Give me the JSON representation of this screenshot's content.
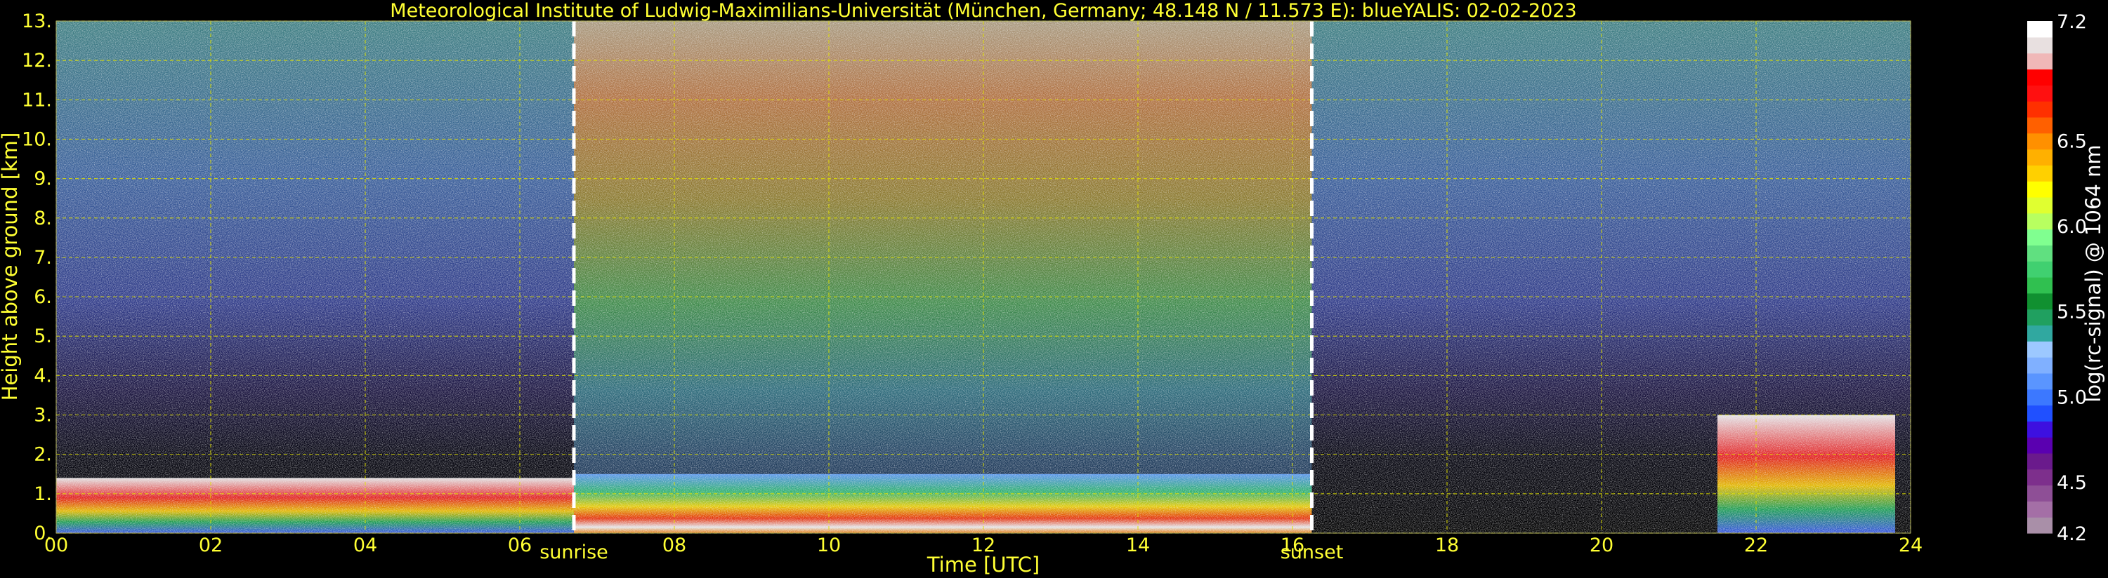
{
  "chart_data": {
    "type": "heatmap",
    "title": "Meteorological Institute of Ludwig-Maximilians-Universität (München, Germany; 48.148 N / 11.573 E):    blueYALIS: 02-02-2023",
    "xlabel": "Time [UTC]",
    "ylabel": "Height above ground [km]",
    "xlim": [
      0,
      24
    ],
    "ylim": [
      0,
      13
    ],
    "x_ticks": [
      "00",
      "02",
      "04",
      "06",
      "08",
      "10",
      "12",
      "14",
      "16",
      "18",
      "20",
      "22",
      "24"
    ],
    "x_tick_values": [
      0,
      2,
      4,
      6,
      8,
      10,
      12,
      14,
      16,
      18,
      20,
      22,
      24
    ],
    "y_ticks": [
      "0.",
      "1.",
      "2.",
      "3.",
      "4.",
      "5.",
      "6.",
      "7.",
      "8.",
      "9.",
      "10.",
      "11.",
      "12.",
      "13."
    ],
    "y_tick_values": [
      0,
      1,
      2,
      3,
      4,
      5,
      6,
      7,
      8,
      9,
      10,
      11,
      12,
      13
    ],
    "grid": true,
    "annotations": [
      {
        "text": "sunrise",
        "x": 6.7
      },
      {
        "text": "sunset",
        "x": 16.25
      }
    ],
    "colorbar": {
      "label": "log(rc-signal) @ 1064 nm",
      "range": [
        4.2,
        7.2
      ],
      "tick_labels": [
        "7.2",
        "6.5",
        "6.0",
        "5.5",
        "5.0",
        "4.5",
        "4.2"
      ],
      "tick_values": [
        7.2,
        6.5,
        6.0,
        5.5,
        5.0,
        4.5,
        4.2
      ],
      "colors": [
        "#a98fa8",
        "#a46fa6",
        "#8e4f96",
        "#7d2f8c",
        "#6a1a8c",
        "#5a00b0",
        "#3d10e0",
        "#2050ff",
        "#3c78ff",
        "#5a95ff",
        "#80b0ff",
        "#9cc8ff",
        "#30a8a0",
        "#20a060",
        "#109030",
        "#30c050",
        "#40d070",
        "#60e080",
        "#80ff90",
        "#b8ff60",
        "#e0ff30",
        "#ffff00",
        "#ffd000",
        "#ffb000",
        "#ff9000",
        "#ff6000",
        "#ff3000",
        "#ff1010",
        "#ff0000",
        "#f0b8b8",
        "#e8e0e0",
        "#ffffff"
      ]
    },
    "zones": [
      {
        "name": "night-aerosol-layer",
        "x": [
          0,
          6.7
        ],
        "y": [
          0,
          1.4
        ]
      },
      {
        "name": "day-boundary-layer",
        "x": [
          6.7,
          16.25
        ],
        "y": [
          0,
          1.5
        ]
      },
      {
        "name": "evening-aerosol-layer",
        "x": [
          21.5,
          23.8
        ],
        "y": [
          0,
          3.0
        ]
      }
    ]
  }
}
